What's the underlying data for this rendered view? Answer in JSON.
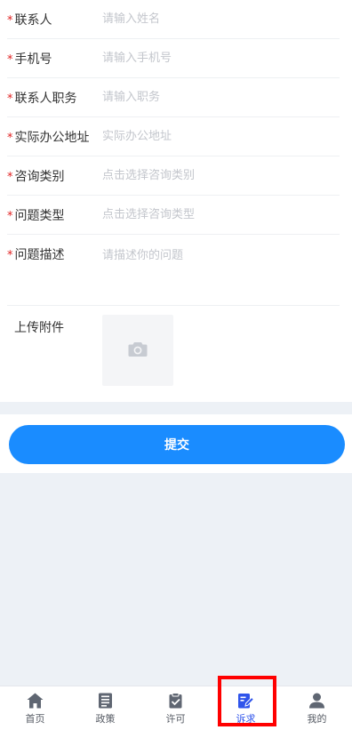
{
  "form": {
    "fields": [
      {
        "label": "联系人",
        "required": "*",
        "placeholder": "请输入姓名"
      },
      {
        "label": "手机号",
        "required": "*",
        "placeholder": "请输入手机号"
      },
      {
        "label": "联系人职务",
        "required": "*",
        "placeholder": "请输入职务"
      },
      {
        "label": "实际办公地址",
        "required": "*",
        "placeholder": "实际办公地址"
      },
      {
        "label": "咨询类别",
        "required": "*",
        "placeholder": "点击选择咨询类别"
      },
      {
        "label": "问题类型",
        "required": "*",
        "placeholder": "点击选择咨询类型"
      },
      {
        "label": "问题描述",
        "required": "*",
        "placeholder": "请描述你的问题"
      }
    ],
    "upload": {
      "label": "上传附件",
      "icon": "camera-icon"
    },
    "submit_label": "提交"
  },
  "tabbar": {
    "items": [
      {
        "label": "首页",
        "icon": "home-icon"
      },
      {
        "label": "政策",
        "icon": "policy-book-icon"
      },
      {
        "label": "许可",
        "icon": "clipboard-check-icon"
      },
      {
        "label": "诉求",
        "icon": "edit-pen-icon"
      },
      {
        "label": "我的",
        "icon": "user-icon"
      }
    ],
    "active_index": 3
  },
  "colors": {
    "primary": "#1a8cff",
    "active_tab": "#2f54eb",
    "required": "#e02020",
    "highlight": "#ff0000",
    "page_bg": "#edf1f6"
  }
}
